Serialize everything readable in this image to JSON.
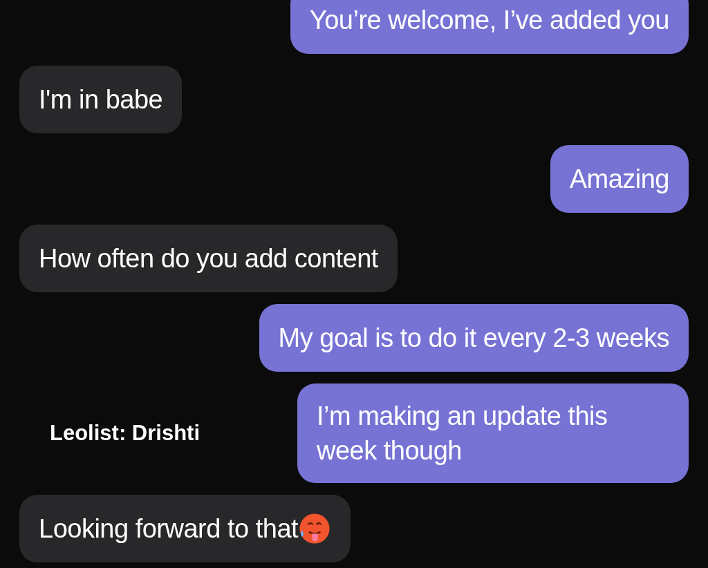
{
  "messages": [
    {
      "kind": "outgoing",
      "text": "You’re welcome, I’ve added you"
    },
    {
      "kind": "incoming",
      "text": "I'm in babe"
    },
    {
      "kind": "outgoing",
      "text": "Amazing"
    },
    {
      "kind": "incoming",
      "text": "How often do you add content"
    },
    {
      "kind": "outgoing",
      "text": "My goal is to do it every 2-3 weeks"
    },
    {
      "kind": "outgoing",
      "text": "I’m making an update this week though",
      "side_caption": "Leolist: Drishti"
    },
    {
      "kind": "incoming",
      "text": "Looking forward to that",
      "emoji": true
    }
  ]
}
